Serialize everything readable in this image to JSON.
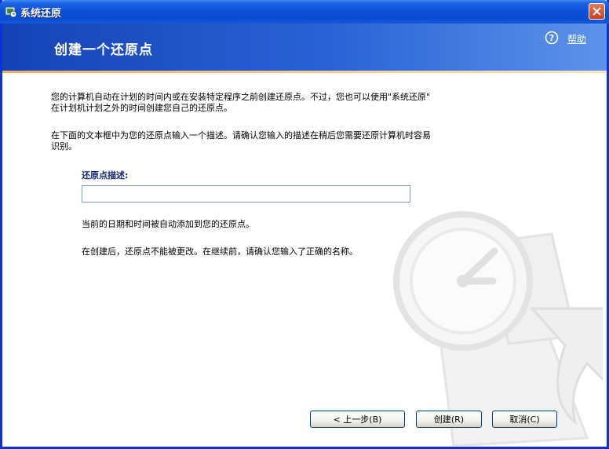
{
  "window": {
    "title": "系统还原"
  },
  "header": {
    "title": "创建一个还原点",
    "help_label": "帮助"
  },
  "content": {
    "intro_line1": "您的计算机自动在计划的时间内或在安装特定程序之前创建还原点。不过，您也可以使用\"系统还原\"",
    "intro_line2": "在计划机计划之外的时间创建您自己的还原点。",
    "instruction_line1": "在下面的文本框中为您的还原点输入一个描述。请确认您输入的描述在稍后您需要还原计算机时容易",
    "instruction_line2": "识别。",
    "field_label": "还原点描述:",
    "input_value": "",
    "note1": "当前的日期和时间被自动添加到您的还原点。",
    "note2": "在创建后，还原点不能被更改。在继续前，请确认您输入了正确的名称。"
  },
  "buttons": {
    "back": "< 上一步(B)",
    "create": "创建(R)",
    "cancel": "取消(C)"
  },
  "colors": {
    "titlebar": "#0b53d6",
    "banner": "#2a63d6",
    "accent": "#f0b060"
  }
}
